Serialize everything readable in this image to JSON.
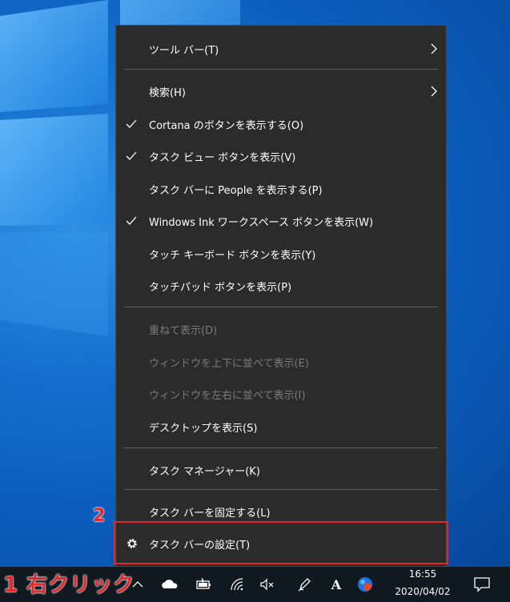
{
  "context_menu": {
    "items": [
      {
        "label": "ツール バー(T)",
        "checked": false,
        "submenu": true,
        "disabled": false
      },
      {
        "label": "検索(H)",
        "checked": false,
        "submenu": true,
        "disabled": false
      },
      {
        "label": "Cortana のボタンを表示する(O)",
        "checked": true,
        "submenu": false,
        "disabled": false
      },
      {
        "label": "タスク ビュー ボタンを表示(V)",
        "checked": true,
        "submenu": false,
        "disabled": false
      },
      {
        "label": "タスク バーに People を表示する(P)",
        "checked": false,
        "submenu": false,
        "disabled": false
      },
      {
        "label": "Windows Ink ワークスペース ボタンを表示(W)",
        "checked": true,
        "submenu": false,
        "disabled": false
      },
      {
        "label": "タッチ キーボード ボタンを表示(Y)",
        "checked": false,
        "submenu": false,
        "disabled": false
      },
      {
        "label": "タッチパッド ボタンを表示(P)",
        "checked": false,
        "submenu": false,
        "disabled": false
      },
      {
        "label": "重ねて表示(D)",
        "checked": false,
        "submenu": false,
        "disabled": true
      },
      {
        "label": "ウィンドウを上下に並べて表示(E)",
        "checked": false,
        "submenu": false,
        "disabled": true
      },
      {
        "label": "ウィンドウを左右に並べて表示(I)",
        "checked": false,
        "submenu": false,
        "disabled": true
      },
      {
        "label": "デスクトップを表示(S)",
        "checked": false,
        "submenu": false,
        "disabled": false
      },
      {
        "label": "タスク マネージャー(K)",
        "checked": false,
        "submenu": false,
        "disabled": false
      },
      {
        "label": "タスク バーを固定する(L)",
        "checked": false,
        "submenu": false,
        "disabled": false
      },
      {
        "label": "タスク バーの設定(T)",
        "checked": false,
        "submenu": false,
        "disabled": false,
        "icon": "gear-icon"
      }
    ]
  },
  "annotations": {
    "step1": "1 右クリック",
    "step2": "2"
  },
  "taskbar": {
    "time": "16:55",
    "date": "2020/04/02",
    "tray_icons": [
      "chevron-up-icon",
      "onedrive-cloud-icon",
      "battery-icon",
      "wifi-icon",
      "speaker-muted-icon",
      "pen-icon",
      "ime-a-icon",
      "edge-icon"
    ],
    "notification_icon": "action-center-icon"
  },
  "colors": {
    "menu_bg": "#2b2b2b",
    "menu_text": "#ffffff",
    "disabled_text": "#7b7b7b",
    "highlight_red": "#e5262a",
    "desktop_blue": "#0b5cbc",
    "taskbar_bg": "#101820"
  }
}
